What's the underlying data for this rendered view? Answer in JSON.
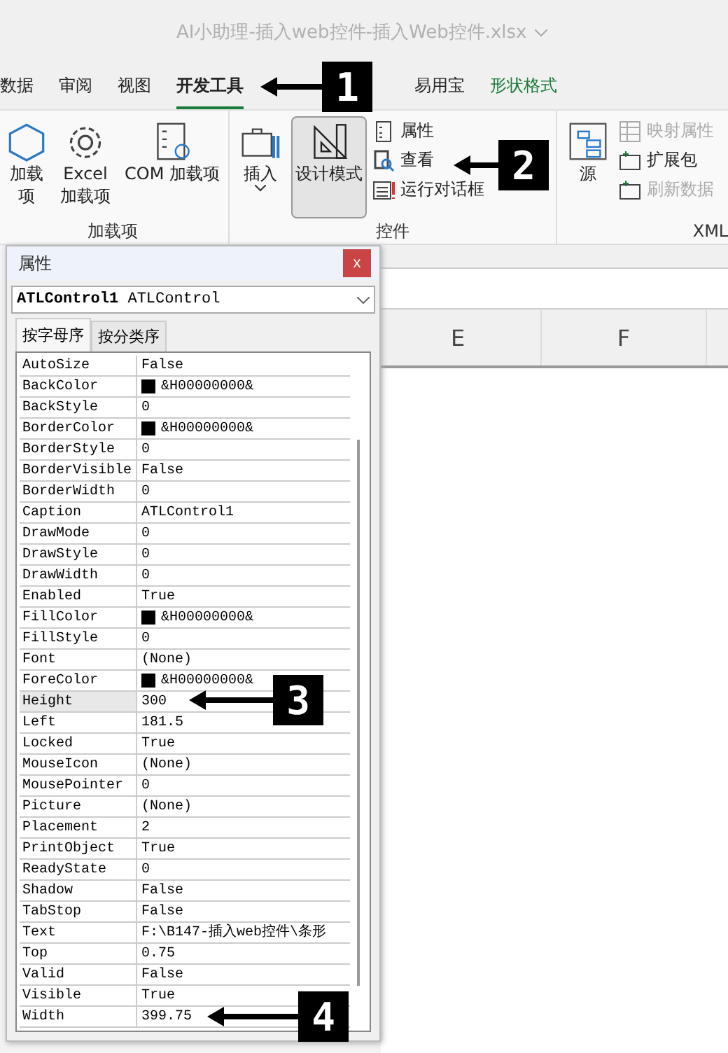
{
  "window": {
    "title": "AI小助理-插入web控件-插入Web控件.xlsx"
  },
  "ribbon_tabs": [
    {
      "label": "数据",
      "selected": false
    },
    {
      "label": "审阅",
      "selected": false
    },
    {
      "label": "视图",
      "selected": false
    },
    {
      "label": "开发工具",
      "selected": true
    },
    {
      "label": "易用宝",
      "selected": false
    },
    {
      "label": "形状格式",
      "selected": false,
      "kind": "context"
    }
  ],
  "ribbon_groups": [
    {
      "label": "加载项",
      "items": [
        {
          "kind": "large",
          "label": "加载项"
        },
        {
          "kind": "large",
          "label": "Excel\n加载项"
        },
        {
          "kind": "large",
          "label": "COM 加载项"
        }
      ]
    },
    {
      "label": "控件",
      "items": [
        {
          "kind": "large",
          "label": "插入",
          "dropdown": true
        },
        {
          "kind": "large",
          "label": "设计模式",
          "selected": true
        },
        {
          "kind": "small",
          "label": "属性",
          "disabled": false
        },
        {
          "kind": "small",
          "label": "查看",
          "disabled": false
        },
        {
          "kind": "small",
          "label": "运行对话框",
          "disabled": false
        }
      ]
    },
    {
      "label": "XML",
      "items": [
        {
          "kind": "large",
          "label": "源"
        },
        {
          "kind": "small",
          "label": "映射属性",
          "disabled": true
        },
        {
          "kind": "small",
          "label": "扩展包",
          "disabled": false
        },
        {
          "kind": "small",
          "label": "刷新数据",
          "disabled": true
        }
      ]
    }
  ],
  "properties_dialog": {
    "title": "属性",
    "close": "x",
    "object": {
      "name": "ATLControl1",
      "type": "ATLControl"
    },
    "tabs": [
      {
        "label": "按字母序",
        "selected": true
      },
      {
        "label": "按分类序",
        "selected": false
      }
    ],
    "rows": [
      {
        "name": "AutoSize",
        "value": "False",
        "selected": false
      },
      {
        "name": "BackColor",
        "value": "&H00000000&",
        "kind": "color",
        "color": "#000000",
        "selected": false
      },
      {
        "name": "BackStyle",
        "value": "0",
        "selected": false
      },
      {
        "name": "BorderColor",
        "value": "&H00000000&",
        "kind": "color",
        "color": "#000000",
        "selected": false
      },
      {
        "name": "BorderStyle",
        "value": "0",
        "selected": false
      },
      {
        "name": "BorderVisible",
        "value": "False",
        "selected": false
      },
      {
        "name": "BorderWidth",
        "value": "0",
        "selected": false
      },
      {
        "name": "Caption",
        "value": "ATLControl1",
        "selected": false
      },
      {
        "name": "DrawMode",
        "value": "0",
        "selected": false
      },
      {
        "name": "DrawStyle",
        "value": "0",
        "selected": false
      },
      {
        "name": "DrawWidth",
        "value": "0",
        "selected": false
      },
      {
        "name": "Enabled",
        "value": "True",
        "selected": false
      },
      {
        "name": "FillColor",
        "value": "&H00000000&",
        "kind": "color",
        "color": "#000000",
        "selected": false
      },
      {
        "name": "FillStyle",
        "value": "0",
        "selected": false
      },
      {
        "name": "Font",
        "value": "(None)",
        "selected": false
      },
      {
        "name": "ForeColor",
        "value": "&H00000000&",
        "kind": "color",
        "color": "#000000",
        "selected": false
      },
      {
        "name": "Height",
        "value": "300",
        "selected": true
      },
      {
        "name": "Left",
        "value": "181.5",
        "selected": false
      },
      {
        "name": "Locked",
        "value": "True",
        "selected": false
      },
      {
        "name": "MouseIcon",
        "value": "(None)",
        "selected": false
      },
      {
        "name": "MousePointer",
        "value": "0",
        "selected": false
      },
      {
        "name": "Picture",
        "value": "(None)",
        "selected": false
      },
      {
        "name": "Placement",
        "value": "2",
        "selected": false
      },
      {
        "name": "PrintObject",
        "value": "True",
        "selected": false
      },
      {
        "name": "ReadyState",
        "value": "0",
        "selected": false
      },
      {
        "name": "Shadow",
        "value": "False",
        "selected": false
      },
      {
        "name": "TabStop",
        "value": "False",
        "selected": false
      },
      {
        "name": "Text",
        "value": "F:\\B147-插入web控件\\条形",
        "selected": false
      },
      {
        "name": "Top",
        "value": "0.75",
        "selected": false
      },
      {
        "name": "Valid",
        "value": "False",
        "selected": false
      },
      {
        "name": "Visible",
        "value": "True",
        "selected": false
      },
      {
        "name": "Width",
        "value": "399.75",
        "selected": false
      }
    ]
  },
  "sheet": {
    "column_headers": [
      "E",
      "F"
    ]
  },
  "callouts": [
    {
      "number": "1"
    },
    {
      "number": "2"
    },
    {
      "number": "3"
    },
    {
      "number": "4"
    }
  ]
}
